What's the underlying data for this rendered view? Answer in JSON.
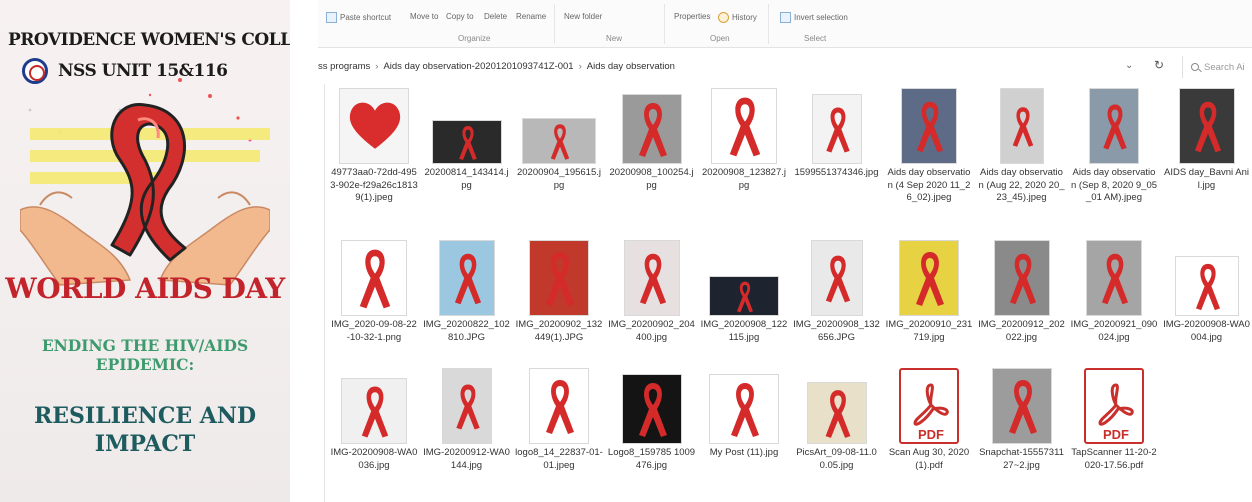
{
  "poster": {
    "college": "PROVIDENCE WOMEN'S COLLEGE",
    "unit": "NSS UNIT 15&116",
    "headline": "WORLD AIDS DAY",
    "subheadline_line1": "ENDING THE HIV/AIDS",
    "subheadline_line2": "EPIDEMIC:",
    "theme_line1": "RESILIENCE AND",
    "theme_line2": "IMPACT",
    "colors": {
      "ribbon": "#d32f2f",
      "headline": "#c3232a",
      "subheadline": "#3c9a6c",
      "theme": "#1e5b5f",
      "hands": "#f2b98f",
      "stripes": "#f4e96a"
    }
  },
  "ribbon": {
    "clipboard": [
      {
        "label": "Paste shortcut",
        "icon": "paste-shortcut-icon"
      }
    ],
    "organize": {
      "label": "Organize",
      "move_to": "Move to",
      "copy_to": "Copy to",
      "delete": "Delete",
      "rename": "Rename"
    },
    "new": {
      "label": "New",
      "new_folder": "New folder"
    },
    "open": {
      "label": "Open",
      "properties": "Properties",
      "history": "History"
    },
    "select": {
      "label": "Select",
      "invert_selection": "Invert selection"
    }
  },
  "address": {
    "segments": [
      "ss programs",
      "Aids day observation-20201201093741Z-001",
      "Aids day observation"
    ],
    "search_placeholder": "Search Ai"
  },
  "files": [
    {
      "name": "49773aa0-72dd-4953-902e-f29a26c18139(1).jpeg",
      "thumb": "heart-collage"
    },
    {
      "name": "20200814_143414.jpg",
      "thumb": "ribbon-drawing-dark"
    },
    {
      "name": "20200904_195615.jpg",
      "thumb": "ribbon-sketch"
    },
    {
      "name": "20200908_100254.jpg",
      "thumb": "ribbon-grey"
    },
    {
      "name": "20200908_123827.jpg",
      "thumb": "ribbon-big"
    },
    {
      "name": "1599551374346.jpg",
      "thumb": "ribbon-thin"
    },
    {
      "name": "Aids day observation (4 Sep 2020 11_26_02).jpeg",
      "thumb": "ribbon-blue"
    },
    {
      "name": "Aids day observation (Aug 22, 2020 20_23_45).jpeg",
      "thumb": "ribbon-circle"
    },
    {
      "name": "Aids day observation (Sep 8, 2020 9_05_01 AM).jpeg",
      "thumb": "ribbon-balloon"
    },
    {
      "name": "AIDS day_Bavni Anil.jpg",
      "thumb": "poster-colorful"
    },
    {
      "name": "IMG_2020-09-08-22-10-32-1.png",
      "thumb": "ribbon-white"
    },
    {
      "name": "IMG_20200822_102810.JPG",
      "thumb": "ribbon-pale"
    },
    {
      "name": "IMG_20200902_132449(1).JPG",
      "thumb": "ribbon-flowers"
    },
    {
      "name": "IMG_20200902_204400.jpg",
      "thumb": "ribbon-tree"
    },
    {
      "name": "IMG_20200908_122115.jpg",
      "thumb": "ribbon-dark-scene"
    },
    {
      "name": "IMG_20200908_132656.JPG",
      "thumb": "ribbon-collage"
    },
    {
      "name": "IMG_20200910_231719.jpg",
      "thumb": "ribbon-yellow"
    },
    {
      "name": "IMG_20200912_202022.jpg",
      "thumb": "ribbon-grey2"
    },
    {
      "name": "IMG_20200921_090024.jpg",
      "thumb": "ribbon-plain"
    },
    {
      "name": "IMG-20200908-WA0004.jpg",
      "thumb": "ribbon-text"
    },
    {
      "name": "IMG-20200908-WA0036.jpg",
      "thumb": "ribbon-heart-frame"
    },
    {
      "name": "IMG-20200912-WA0144.jpg",
      "thumb": "ribbon-folded"
    },
    {
      "name": "logo8_14_22837-01-01.jpeg",
      "thumb": "aids-day-hands"
    },
    {
      "name": "Logo8_159785 1009476.jpg",
      "thumb": "ribbon-black"
    },
    {
      "name": "My Post (11).jpg",
      "thumb": "ribbon-heart-small"
    },
    {
      "name": "PicsArt_09-08-11.00.05.jpg",
      "thumb": "ribbon-badge"
    },
    {
      "name": "Scan Aug 30, 2020 (1).pdf",
      "thumb": "pdf"
    },
    {
      "name": "Snapchat-1555731127~2.jpg",
      "thumb": "ribbon-large-grey"
    },
    {
      "name": "TapScanner 11-20-2020-17.56.pdf",
      "thumb": "pdf"
    }
  ],
  "pdf_label": "PDF"
}
